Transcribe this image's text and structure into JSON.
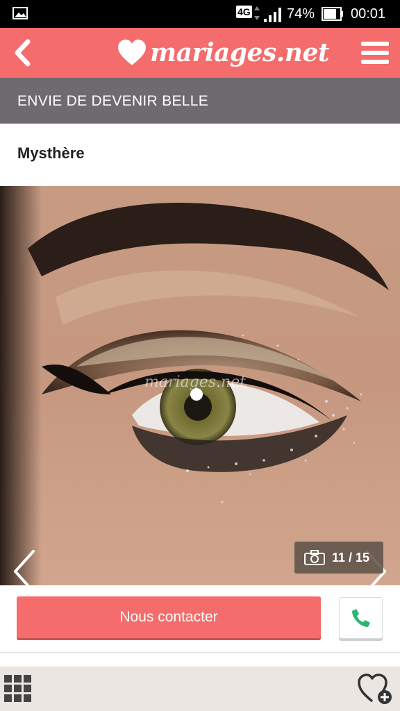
{
  "status_bar": {
    "network": "4G",
    "battery": "74%",
    "time": "00:01",
    "icons": [
      "gallery-icon",
      "data-arrows-icon",
      "signal-icon",
      "battery-icon"
    ]
  },
  "header": {
    "logo_text": "mariages.net",
    "back_icon": "chevron-left-icon",
    "menu_icon": "hamburger-icon",
    "background": "#f46c6c"
  },
  "category": {
    "label": "ENVIE DE DEVENIR BELLE",
    "background": "#6f6a6f"
  },
  "post": {
    "title": "Mysthère"
  },
  "gallery": {
    "watermark": "mariages.net",
    "counter": "11 / 15",
    "prev_icon": "chevron-left-icon",
    "next_icon": "chevron-right-icon",
    "camera_icon": "camera-icon"
  },
  "actions": {
    "contact_label": "Nous contacter",
    "phone_icon": "phone-icon",
    "accent": "#f46c6c",
    "phone_color": "#2bb673"
  },
  "bottom_nav": {
    "grid_icon": "grid-icon",
    "favorite_icon": "heart-plus-icon"
  }
}
